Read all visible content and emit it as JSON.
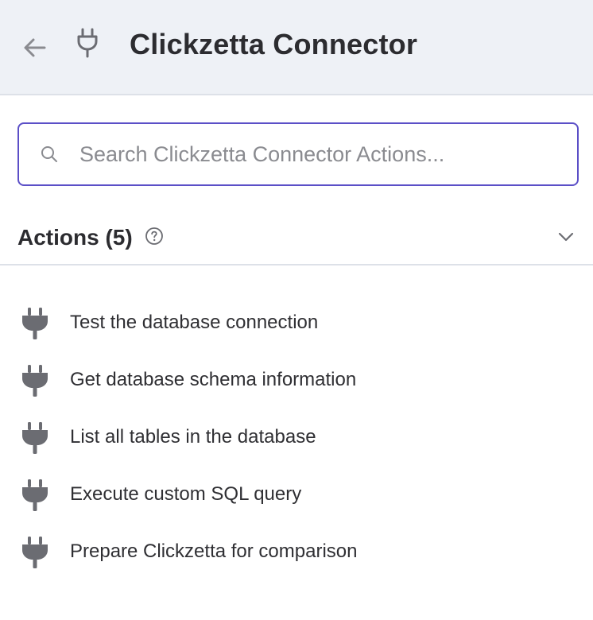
{
  "header": {
    "title": "Clickzetta Connector",
    "back_icon": "arrow-left-icon",
    "app_icon": "plug-icon"
  },
  "search": {
    "placeholder": "Search Clickzetta Connector Actions...",
    "value": "",
    "icon": "search-icon"
  },
  "actions_section": {
    "title": "Actions (5)",
    "help_icon": "help-circle-icon",
    "toggle_icon": "chevron-down-icon",
    "items": [
      {
        "label": "Test the database connection",
        "icon": "plug-icon"
      },
      {
        "label": "Get database schema information",
        "icon": "plug-icon"
      },
      {
        "label": "List all tables in the database",
        "icon": "plug-icon"
      },
      {
        "label": "Execute custom SQL query",
        "icon": "plug-icon"
      },
      {
        "label": "Prepare Clickzetta for comparison",
        "icon": "plug-icon"
      }
    ]
  },
  "colors": {
    "header_bg": "#eef1f6",
    "accent_border": "#5b4fc7",
    "icon_gray": "#6b6c72",
    "text_dark": "#2c2c30",
    "placeholder": "#8a8b90"
  }
}
